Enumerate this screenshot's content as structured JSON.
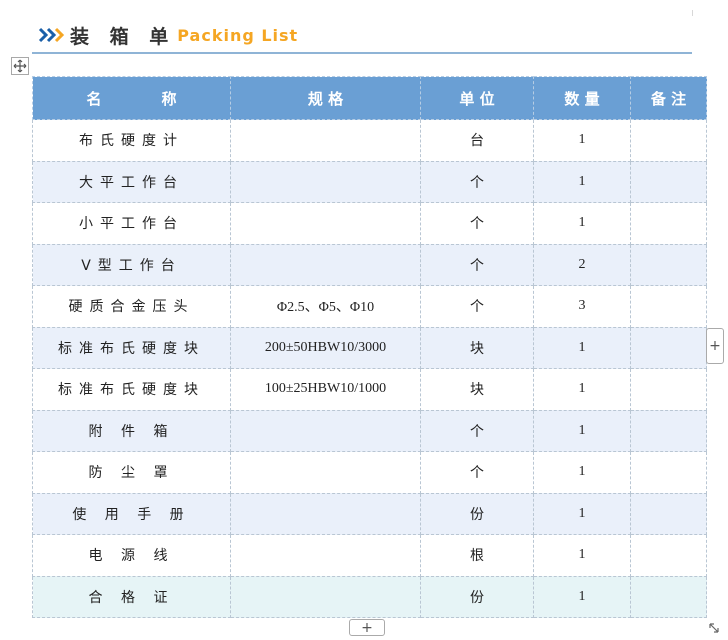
{
  "header": {
    "title_cn": "装 箱 单",
    "title_en": "Packing List",
    "accent_color": "#f5a623",
    "chevron_color": "#1a5fa8",
    "icon": "triple-chevron-right-icon"
  },
  "table": {
    "header_color": "#6a9fd4",
    "columns": [
      "名　　　　称",
      "规 格",
      "单 位",
      "数 量",
      "备 注"
    ],
    "rows": [
      {
        "name": "布氏硬度计",
        "spec": "",
        "unit": "台",
        "qty": "1",
        "note": ""
      },
      {
        "name": "大平工作台",
        "spec": "",
        "unit": "个",
        "qty": "1",
        "note": ""
      },
      {
        "name": "小平工作台",
        "spec": "",
        "unit": "个",
        "qty": "1",
        "note": ""
      },
      {
        "name": "V型工作台",
        "spec": "",
        "unit": "个",
        "qty": "2",
        "note": ""
      },
      {
        "name": "硬质合金压头",
        "spec": "Φ2.5、Φ5、Φ10",
        "unit": "个",
        "qty": "3",
        "note": ""
      },
      {
        "name": "标准布氏硬度块",
        "spec": "200±50HBW10/3000",
        "unit": "块",
        "qty": "1",
        "note": ""
      },
      {
        "name": "标准布氏硬度块",
        "spec": "100±25HBW10/1000",
        "unit": "块",
        "qty": "1",
        "note": ""
      },
      {
        "name": "附 件 箱",
        "spec": "",
        "unit": "个",
        "qty": "1",
        "note": ""
      },
      {
        "name": "防 尘 罩",
        "spec": "",
        "unit": "个",
        "qty": "1",
        "note": ""
      },
      {
        "name": "使 用 手 册",
        "spec": "",
        "unit": "份",
        "qty": "1",
        "note": ""
      },
      {
        "name": "电 源 线",
        "spec": "",
        "unit": "根",
        "qty": "1",
        "note": ""
      },
      {
        "name": "合 格 证",
        "spec": "",
        "unit": "份",
        "qty": "1",
        "note": ""
      }
    ]
  },
  "controls": {
    "move_icon": "move-handle-icon",
    "add_glyph": "+",
    "resize_icon": "resize-diagonal-icon"
  }
}
